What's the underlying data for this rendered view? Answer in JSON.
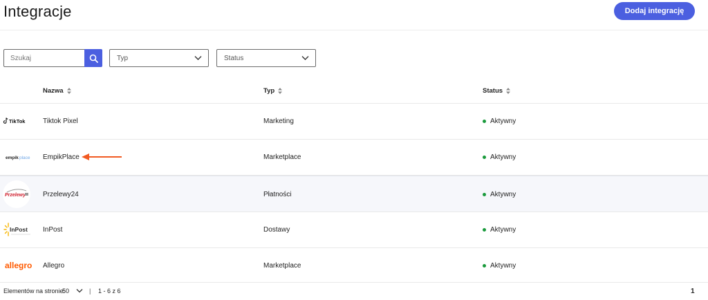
{
  "header": {
    "title": "Integracje",
    "add_button": "Dodaj integrację"
  },
  "filters": {
    "search_placeholder": "Szukaj",
    "type_placeholder": "Typ",
    "status_placeholder": "Status"
  },
  "table": {
    "columns": [
      "Nazwa",
      "Typ",
      "Status"
    ],
    "rows": [
      {
        "name": "Tiktok Pixel",
        "type": "Marketing",
        "status": "Aktywny",
        "logo": "tiktok-logo"
      },
      {
        "name": "EmpikPlace",
        "type": "Marketplace",
        "status": "Aktywny",
        "logo": "empikplace-logo"
      },
      {
        "name": "Przelewy24",
        "type": "Płatności",
        "status": "Aktywny",
        "logo": "przelewy24-logo"
      },
      {
        "name": "InPost",
        "type": "Dostawy",
        "status": "Aktywny",
        "logo": "inpost-logo"
      },
      {
        "name": "Allegro",
        "type": "Marketplace",
        "status": "Aktywny",
        "logo": "allegro-logo"
      }
    ]
  },
  "logos": {
    "tiktok_text": "TikTok",
    "empik_text_a": "empik",
    "empik_text_b": "place",
    "przelewy_text": "Przelewy",
    "inpost_text": "InPost",
    "allegro_text": "allegro"
  },
  "footer": {
    "per_page_label": "Elementów na stronie:",
    "per_page_value": "50",
    "separator": "|",
    "range": "1 - 6 z 6",
    "current_page": "1"
  },
  "colors": {
    "accent": "#4b5fe0",
    "status_active": "#1a9a3c",
    "annotation_arrow": "#f15a22",
    "allegro": "#ff5a00",
    "przelewy_red": "#d0202f"
  }
}
